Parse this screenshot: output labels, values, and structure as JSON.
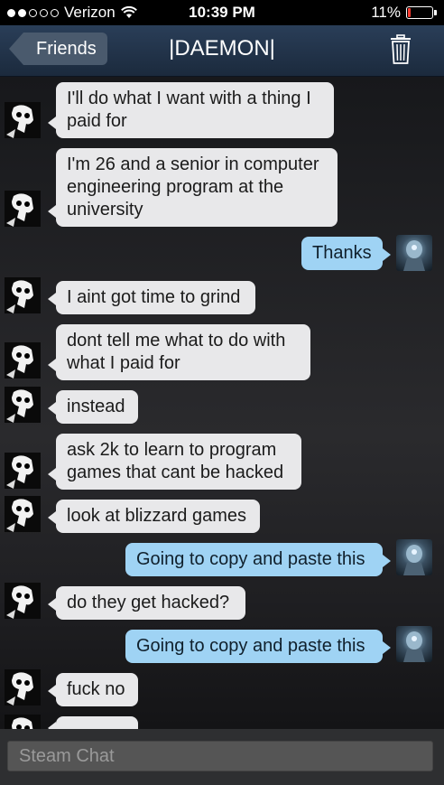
{
  "status_bar": {
    "carrier": "Verizon",
    "time": "10:39 PM",
    "battery_percent": "11%",
    "signal_bars_filled": 2
  },
  "nav": {
    "back_label": "Friends",
    "title": "|DAEMON|",
    "delete_icon": "trash-icon"
  },
  "messages": [
    {
      "from": "them",
      "text": "I'll do what I want with a thing I paid for"
    },
    {
      "from": "them",
      "text": "I'm 26 and a senior in computer engineering program at the university"
    },
    {
      "from": "me",
      "text": "Thanks"
    },
    {
      "from": "them",
      "text": "I aint got time to grind"
    },
    {
      "from": "them",
      "text": "dont tell me what to do with what I paid for"
    },
    {
      "from": "them",
      "text": "instead"
    },
    {
      "from": "them",
      "text": "ask 2k to learn to program games that cant be hacked"
    },
    {
      "from": "them",
      "text": "look at blizzard games"
    },
    {
      "from": "me",
      "text": "Going to copy and paste this"
    },
    {
      "from": "them",
      "text": "do they get hacked?"
    },
    {
      "from": "me",
      "text": "Going to copy and paste this"
    },
    {
      "from": "them",
      "text": "fuck no"
    }
  ],
  "input": {
    "placeholder": "Steam Chat"
  },
  "colors": {
    "incoming_bubble": "#e8e8ea",
    "outgoing_bubble": "#9fd3f4",
    "nav_bar": "#1b2a3d"
  }
}
